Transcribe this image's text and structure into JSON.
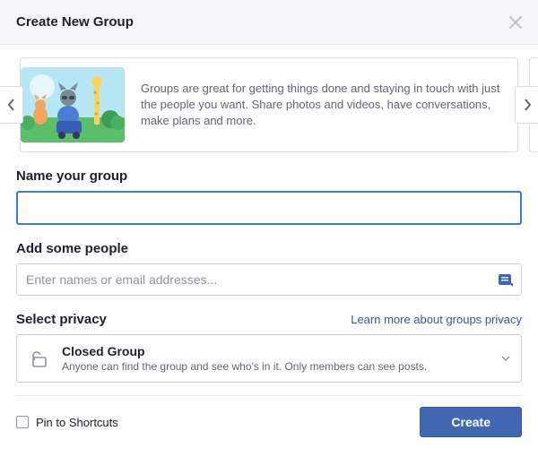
{
  "header": {
    "title": "Create New Group"
  },
  "info": {
    "text": "Groups are great for getting things done and staying in touch with just the people you want. Share photos and videos, have conversations, make plans and more."
  },
  "name": {
    "label": "Name your group",
    "value": ""
  },
  "people": {
    "label": "Add some people",
    "placeholder": "Enter names or email addresses..."
  },
  "privacy": {
    "label": "Select privacy",
    "learn_more": "Learn more about groups privacy",
    "selected": {
      "title": "Closed Group",
      "description": "Anyone can find the group and see who's in it. Only members can see posts."
    }
  },
  "footer": {
    "pin_label": "Pin to Shortcuts",
    "pin_checked": false,
    "create_label": "Create"
  }
}
